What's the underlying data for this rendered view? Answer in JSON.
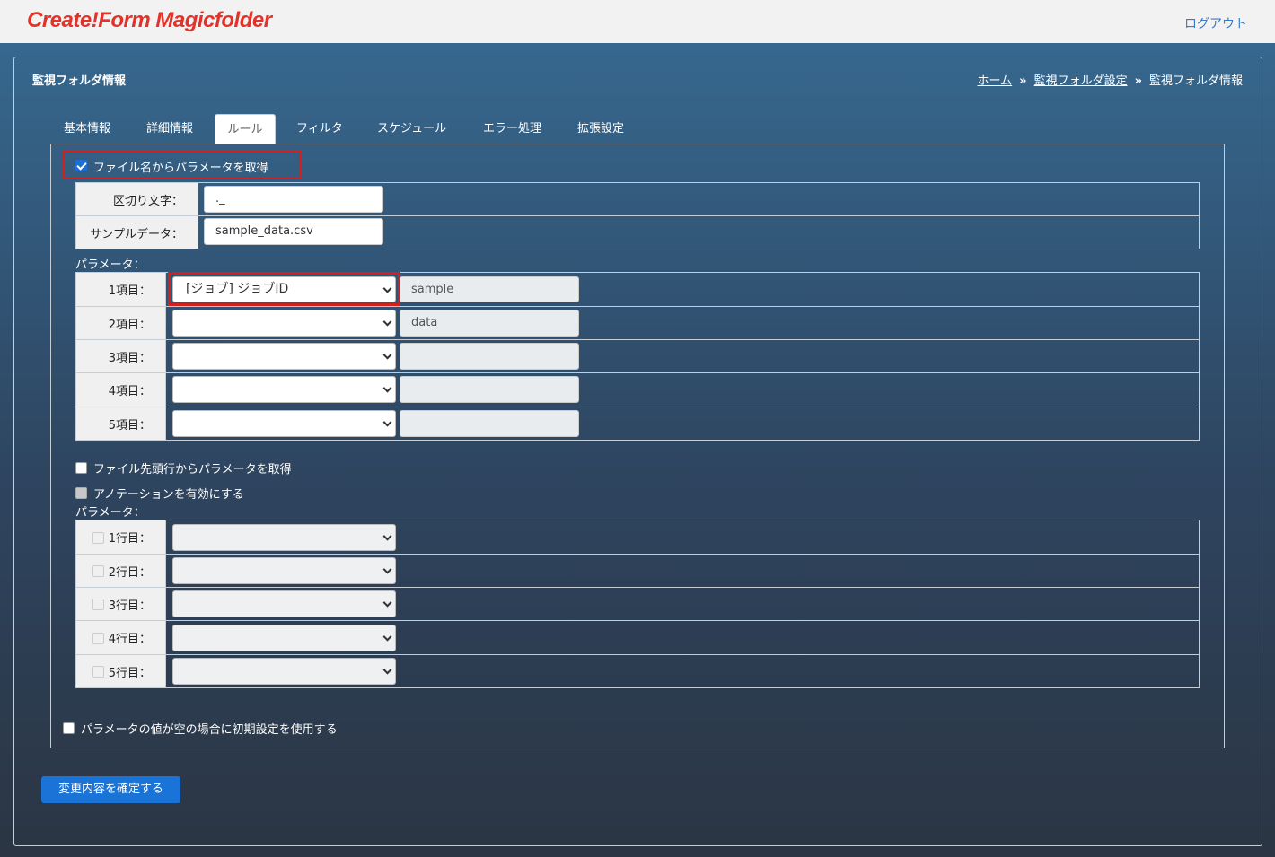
{
  "header": {
    "logo": "Create!Form Magicfolder",
    "logout": "ログアウト"
  },
  "page": {
    "title": "監視フォルダ情報"
  },
  "breadcrumb": {
    "home": "ホーム",
    "sep": "»",
    "parent": "監視フォルダ設定",
    "current": "監視フォルダ情報"
  },
  "tabs": [
    "基本情報",
    "詳細情報",
    "ルール",
    "フィルタ",
    "スケジュール",
    "エラー処理",
    "拡張設定"
  ],
  "active_tab": "ルール",
  "filename_params": {
    "checkbox_label": "ファイル名からパラメータを取得",
    "checked": true,
    "delimiter_label": "区切り文字：",
    "delimiter_value": "._",
    "sample_label": "サンプルデータ：",
    "sample_value": "sample_data.csv",
    "params_heading": "パラメータ：",
    "rows": [
      {
        "label": "1項目：",
        "select": "[ジョブ] ジョブID",
        "value": "sample"
      },
      {
        "label": "2項目：",
        "select": "",
        "value": "data"
      },
      {
        "label": "3項目：",
        "select": "",
        "value": ""
      },
      {
        "label": "4項目：",
        "select": "",
        "value": ""
      },
      {
        "label": "5項目：",
        "select": "",
        "value": ""
      }
    ]
  },
  "header_params": {
    "checkbox_label": "ファイル先頭行からパラメータを取得",
    "checked": false
  },
  "annotation": {
    "checkbox_label": "アノテーションを有効にする",
    "disabled": true,
    "params_heading": "パラメータ：",
    "rows": [
      {
        "label": "1行目："
      },
      {
        "label": "2行目："
      },
      {
        "label": "3行目："
      },
      {
        "label": "4行目："
      },
      {
        "label": "5行目："
      }
    ]
  },
  "use_default": {
    "checkbox_label": "パラメータの値が空の場合に初期設定を使用する",
    "checked": false
  },
  "submit_label": "変更内容を確定する",
  "colors": {
    "logo": "#e3322a",
    "link": "#3a7bc8",
    "highlight": "#d41f1f",
    "primary_button": "#1a73d6"
  }
}
